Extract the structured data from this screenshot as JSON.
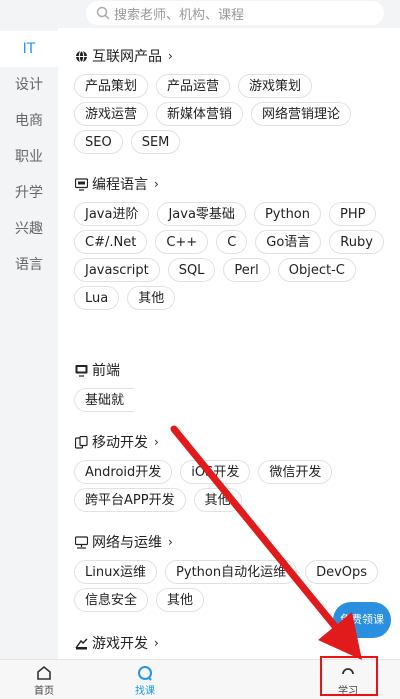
{
  "search": {
    "placeholder": "搜索老师、机构、课程"
  },
  "sidebar": {
    "items": [
      "IT",
      "设计",
      "电商",
      "职业",
      "升学",
      "兴趣",
      "语言"
    ]
  },
  "sections": [
    {
      "title": "互联网产品",
      "icon": "globe-icon",
      "tags": [
        "产品策划",
        "产品运营",
        "游戏策划",
        "游戏运营",
        "新媒体营销",
        "网络营销理论",
        "SEO",
        "SEM"
      ]
    },
    {
      "title": "编程语言",
      "icon": "monitor-code-icon",
      "tags": [
        "Java进阶",
        "Java零基础",
        "Python",
        "PHP",
        "C#/.Net",
        "C++",
        "C",
        "Go语言",
        "Ruby",
        "Javascript",
        "SQL",
        "Perl",
        "Object-C",
        "Lua",
        "其他"
      ]
    },
    {
      "title": "前端",
      "icon": "monitor-icon",
      "tags": [
        "基础就"
      ]
    },
    {
      "title": "移动开发",
      "icon": "mobile-copy-icon",
      "tags": [
        "Android开发",
        "iOS开发",
        "微信开发",
        "跨平台APP开发",
        "其他"
      ]
    },
    {
      "title": "网络与运维",
      "icon": "network-icon",
      "tags": [
        "Linux运维",
        "Python自动化运维",
        "DevOps",
        "信息安全",
        "其他"
      ]
    },
    {
      "title": "游戏开发",
      "icon": "game-icon",
      "tags": []
    }
  ],
  "promo": {
    "label": "免费领课"
  },
  "tabbar": {
    "home": "首页",
    "find": "找课",
    "study": "学习"
  },
  "colors": {
    "accent": "#2196f3",
    "arrow": "#e11b1b"
  }
}
